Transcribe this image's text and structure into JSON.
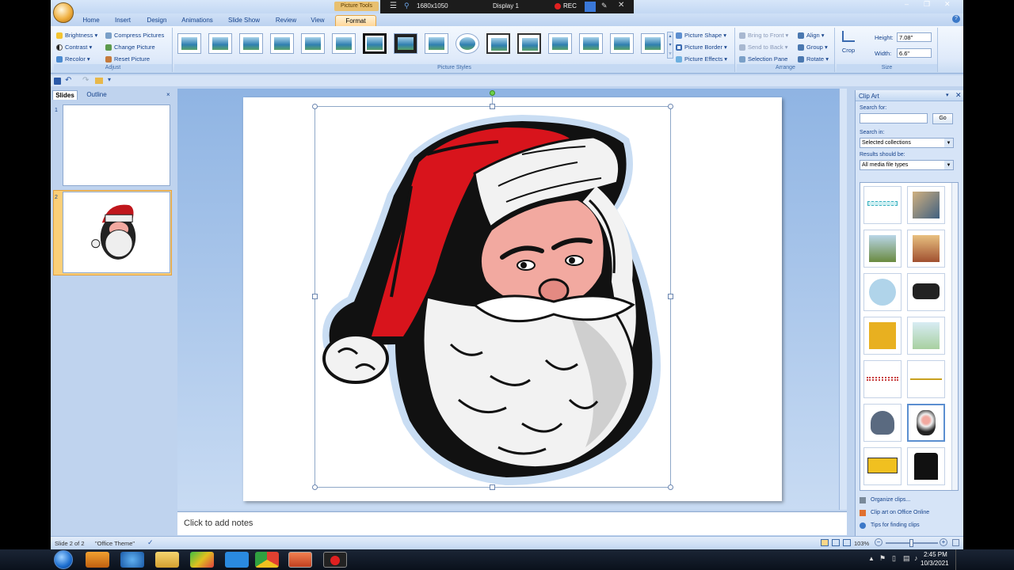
{
  "title_bar": {
    "context_tab": "Picture Tools",
    "resolution": "1680x1050",
    "display": "Display 1",
    "rec": "REC"
  },
  "tabs": [
    "Home",
    "Insert",
    "Design",
    "Animations",
    "Slide Show",
    "Review",
    "View",
    "Format"
  ],
  "active_tab": "Format",
  "ribbon": {
    "adjust": {
      "label": "Adjust",
      "brightness": "Brightness",
      "contrast": "Contrast",
      "recolor": "Recolor",
      "compress": "Compress Pictures",
      "change": "Change Picture",
      "reset": "Reset Picture"
    },
    "picture_styles": {
      "label": "Picture Styles",
      "shape": "Picture Shape",
      "border": "Picture Border",
      "effects": "Picture Effects"
    },
    "arrange": {
      "label": "Arrange",
      "bring_front": "Bring to Front",
      "send_back": "Send to Back",
      "selection_pane": "Selection Pane",
      "align": "Align",
      "group": "Group",
      "rotate": "Rotate"
    },
    "size": {
      "label": "Size",
      "crop": "Crop",
      "height_label": "Height:",
      "height": "7.08\"",
      "width_label": "Width:",
      "width": "6.6\""
    }
  },
  "left_pane": {
    "tab_slides": "Slides",
    "tab_outline": "Outline",
    "slide_numbers": [
      "1",
      "2"
    ]
  },
  "notes_placeholder": "Click to add notes",
  "clip_art": {
    "title": "Clip Art",
    "search_for": "Search for:",
    "go": "Go",
    "search_in": "Search in:",
    "search_in_value": "Selected collections",
    "results_label": "Results should be:",
    "results_value": "All media file types",
    "organize": "Organize clips...",
    "online": "Clip art on Office Online",
    "tips": "Tips for finding clips"
  },
  "status": {
    "slide": "Slide 2 of 2",
    "theme": "\"Office Theme\"",
    "zoom": "103%"
  },
  "clock": {
    "time": "2:45 PM",
    "date": "10/3/2021"
  },
  "colors": {
    "ribbon_blue": "#bfd3ee",
    "active_tab": "#ffd79a",
    "santa_red": "#d8141c",
    "skin": "#f2a9a0"
  }
}
